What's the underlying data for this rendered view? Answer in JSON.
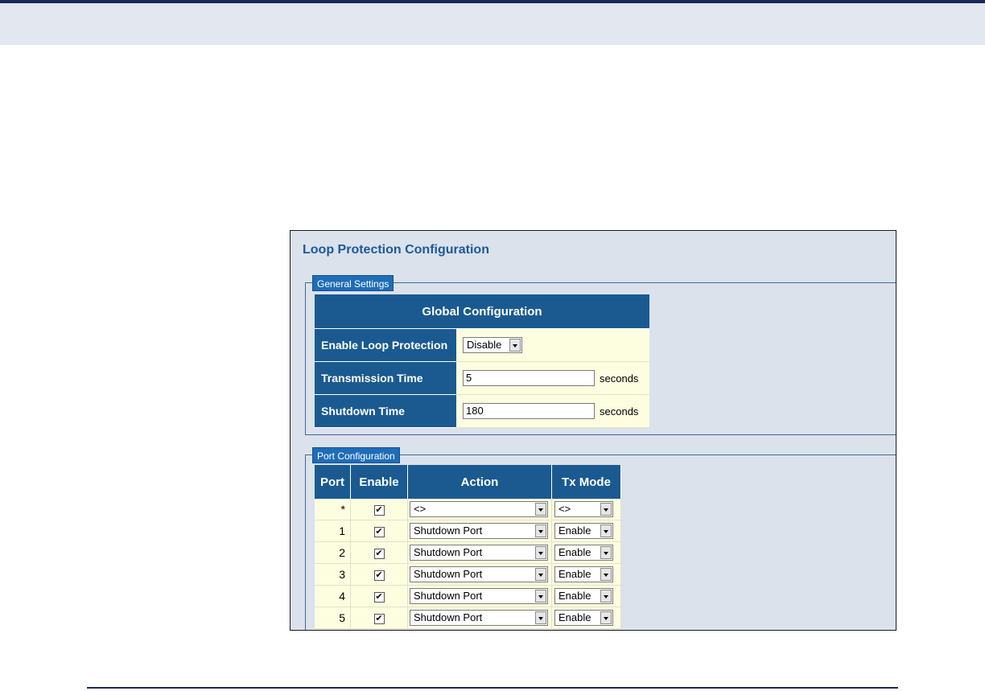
{
  "page": {
    "title": "Loop Protection Configuration"
  },
  "general": {
    "legend": "General Settings",
    "header": "Global Configuration",
    "enable_label": "Enable Loop Protection",
    "enable_value": "Disable",
    "transmission_label": "Transmission Time",
    "transmission_value": "5",
    "transmission_unit": "seconds",
    "shutdown_label": "Shutdown Time",
    "shutdown_value": "180",
    "shutdown_unit": "seconds"
  },
  "port_config": {
    "legend": "Port Configuration",
    "columns": [
      "Port",
      "Enable",
      "Action",
      "Tx Mode"
    ],
    "rows": [
      {
        "port": "*",
        "enabled": true,
        "action": "<>",
        "tx_mode": "<>"
      },
      {
        "port": "1",
        "enabled": true,
        "action": "Shutdown Port",
        "tx_mode": "Enable"
      },
      {
        "port": "2",
        "enabled": true,
        "action": "Shutdown Port",
        "tx_mode": "Enable"
      },
      {
        "port": "3",
        "enabled": true,
        "action": "Shutdown Port",
        "tx_mode": "Enable"
      },
      {
        "port": "4",
        "enabled": true,
        "action": "Shutdown Port",
        "tx_mode": "Enable"
      },
      {
        "port": "5",
        "enabled": true,
        "action": "Shutdown Port",
        "tx_mode": "Enable"
      }
    ]
  },
  "icons": {
    "checkbox": "checkbox-checked-icon",
    "dropdown": "chevron-down-icon"
  },
  "colors": {
    "header_bg": "#1a5a90",
    "cell_bg": "#fdfde0",
    "panel_bg": "#dbe2ec",
    "title": "#1c5a99",
    "legend_bg": "#1e6db8",
    "top_rule": "#17295a"
  }
}
